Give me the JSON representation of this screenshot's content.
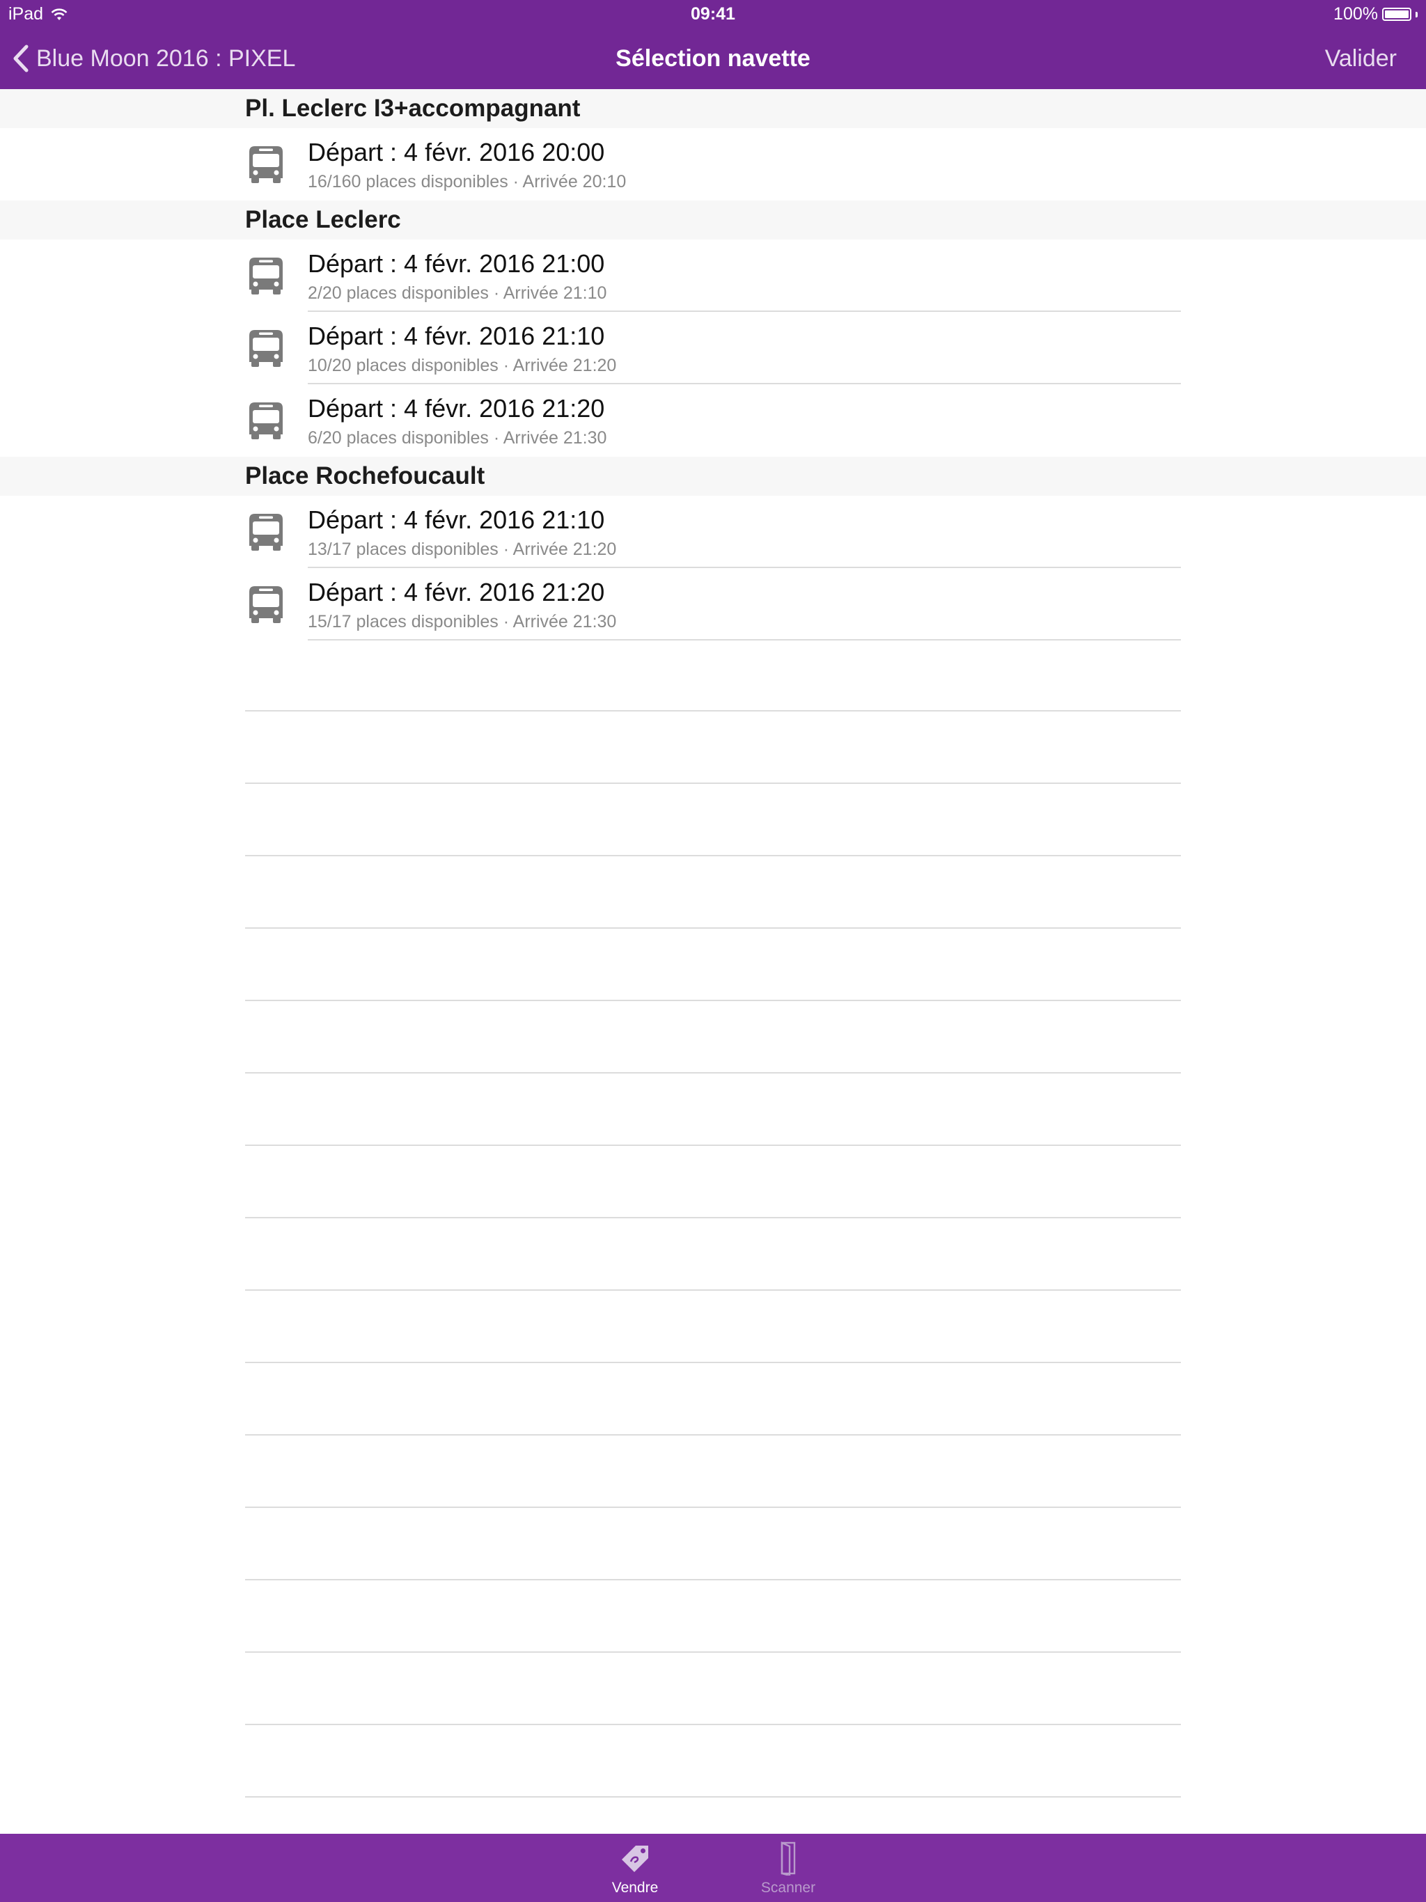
{
  "status_bar": {
    "carrier": "iPad",
    "time": "09:41",
    "battery": "100%"
  },
  "nav": {
    "back_label": "Blue Moon 2016 : PIXEL",
    "title": "Sélection navette",
    "right_label": "Valider"
  },
  "sections": [
    {
      "title": "Pl. Leclerc I3+accompagnant",
      "rows": [
        {
          "title": "Départ : 4 févr. 2016 20:00",
          "subtitle": "16/160 places disponibles · Arrivée 20:10"
        }
      ]
    },
    {
      "title": "Place Leclerc",
      "rows": [
        {
          "title": "Départ : 4 févr. 2016 21:00",
          "subtitle": "2/20 places disponibles · Arrivée 21:10"
        },
        {
          "title": "Départ : 4 févr. 2016 21:10",
          "subtitle": "10/20 places disponibles · Arrivée 21:20"
        },
        {
          "title": "Départ : 4 févr. 2016 21:20",
          "subtitle": "6/20 places disponibles · Arrivée 21:30"
        }
      ]
    },
    {
      "title": "Place Rochefoucault",
      "rows": [
        {
          "title": "Départ : 4 févr. 2016 21:10",
          "subtitle": "13/17 places disponibles · Arrivée 21:20"
        },
        {
          "title": "Départ : 4 févr. 2016 21:20",
          "subtitle": "15/17 places disponibles · Arrivée 21:30"
        }
      ]
    }
  ],
  "tabs": [
    {
      "label": "Vendre",
      "icon": "tag-icon",
      "active": true
    },
    {
      "label": "Scanner",
      "icon": "door-icon",
      "active": false
    }
  ],
  "colors": {
    "nav_bar": "#722795",
    "tab_bar": "#7d2fa0",
    "section_header_bg": "#f7f7f7",
    "bus_icon": "#7a7a7a"
  }
}
